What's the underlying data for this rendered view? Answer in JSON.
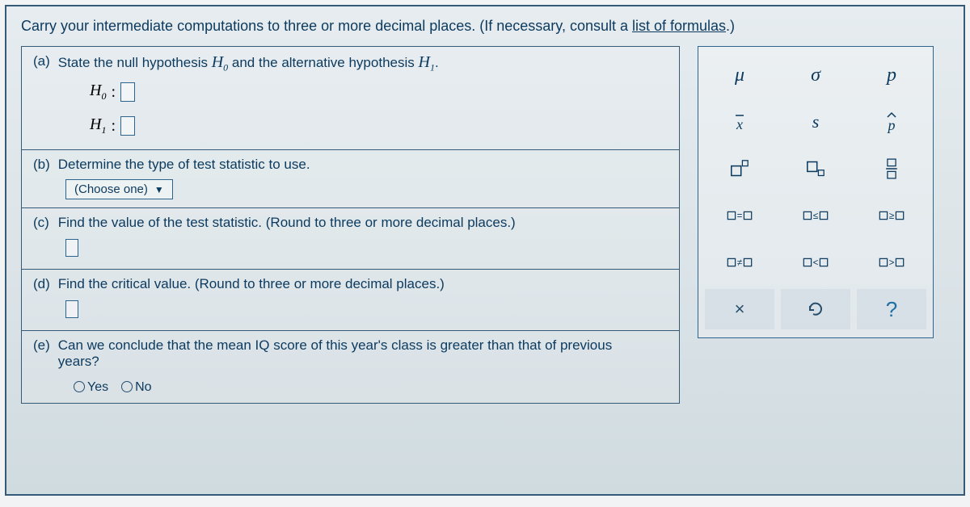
{
  "instructions": {
    "main": "Carry your intermediate computations to three or more decimal places. (If necessary, consult a ",
    "link": "list of formulas",
    "tail": ".)"
  },
  "questions": {
    "a": {
      "label": "(a)",
      "text_before": "State the null hypothesis ",
      "h0_sym": "H",
      "h0_sub": "0",
      "text_mid": " and the alternative hypothesis ",
      "h1_sym": "H",
      "h1_sub": "1",
      "text_after": ".",
      "h0_line_sym": "H",
      "h0_line_sub": "0",
      "h1_line_sym": "H",
      "h1_line_sub": "1",
      "colon": ":"
    },
    "b": {
      "label": "(b)",
      "text": "Determine the type of test statistic to use.",
      "select_label": "(Choose one)",
      "caret": "▼"
    },
    "c": {
      "label": "(c)",
      "text": "Find the value of the test statistic. (Round to three or more decimal places.)"
    },
    "d": {
      "label": "(d)",
      "text": "Find the critical value. (Round to three or more decimal places.)"
    },
    "e": {
      "label": "(e)",
      "text": "Can we conclude that the mean IQ score of this year's class is greater than that of previous years?",
      "yes": "Yes",
      "no": "No"
    }
  },
  "palette": {
    "mu": "μ",
    "sigma": "σ",
    "p": "p",
    "xbar": "x̄",
    "s": "s",
    "phat": "p̂",
    "eq": "=",
    "le": "≤",
    "ge": "≥",
    "ne": "≠",
    "lt": "<",
    "gt": ">",
    "clear": "×",
    "reset": "↺",
    "help": "?"
  }
}
